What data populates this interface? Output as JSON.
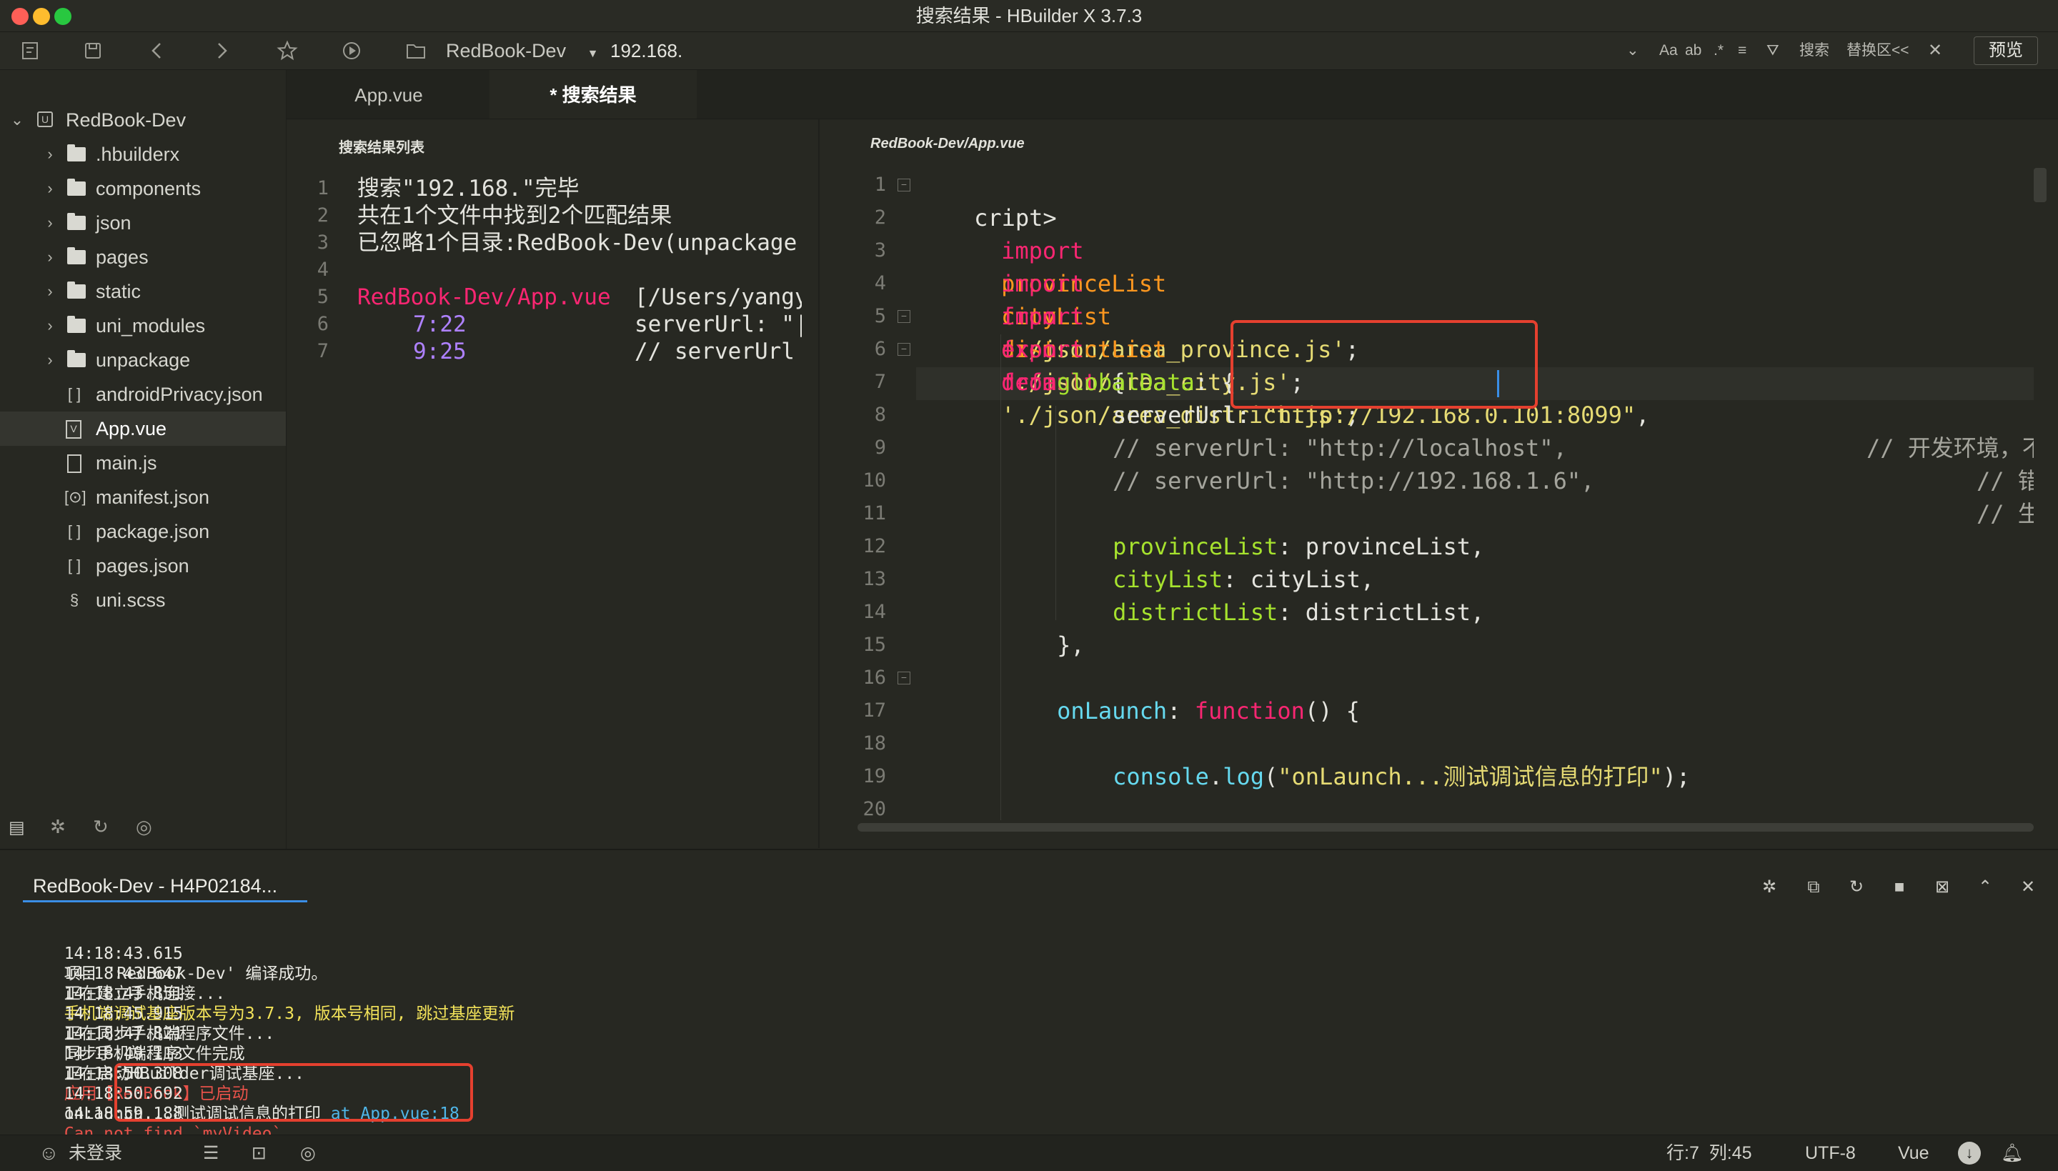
{
  "window": {
    "title": "搜索结果 - HBuilder X 3.7.3"
  },
  "toolbar": {
    "project": "RedBook-Dev",
    "search_value": "192.168.",
    "search_label": "搜索",
    "replace_label": "替换区<<",
    "preview_label": "预览"
  },
  "sidebar": {
    "root": "RedBook-Dev",
    "items": [
      {
        "label": ".hbuilderx",
        "type": "folder"
      },
      {
        "label": "components",
        "type": "folder"
      },
      {
        "label": "json",
        "type": "folder"
      },
      {
        "label": "pages",
        "type": "folder"
      },
      {
        "label": "static",
        "type": "folder"
      },
      {
        "label": "uni_modules",
        "type": "folder"
      },
      {
        "label": "unpackage",
        "type": "folder"
      },
      {
        "label": "androidPrivacy.json",
        "type": "json"
      },
      {
        "label": "App.vue",
        "type": "vue"
      },
      {
        "label": "main.js",
        "type": "js"
      },
      {
        "label": "manifest.json",
        "type": "manifest"
      },
      {
        "label": "package.json",
        "type": "json"
      },
      {
        "label": "pages.json",
        "type": "json"
      },
      {
        "label": "uni.scss",
        "type": "scss"
      }
    ]
  },
  "tabs": [
    {
      "label": "App.vue"
    },
    {
      "label": "* 搜索结果"
    }
  ],
  "results": {
    "title": "搜索结果列表",
    "line_numbers": [
      "1",
      "2",
      "3",
      "4",
      "5",
      "6",
      "7"
    ],
    "lines": [
      "搜索\"192.168.\"完毕",
      "共在1个文件中找到2个匹配结果",
      "已忽略1个目录:RedBook-Dev(unpackage",
      "",
      "RedBook-Dev/App.vue",
      "7:22",
      "9:25"
    ],
    "file_path_suffix": "[/Users/yangy",
    "match_7_22": "serverUrl: \"|",
    "match_9_25": "// serverUrl"
  },
  "editor": {
    "path": "RedBook-Dev/App.vue",
    "line_numbers": [
      "1",
      "2",
      "3",
      "4",
      "5",
      "6",
      "7",
      "8",
      "9",
      "10",
      "11",
      "12",
      "13",
      "14",
      "15",
      "16",
      "17",
      "18",
      "19",
      "20"
    ],
    "l1": "cript>",
    "l2_kw": "import",
    "l2_id": "provinceList",
    "l2_from": "from",
    "l2_str": "'./json/area_province.js'",
    "l2_end": ";",
    "l3_kw": "import",
    "l3_id": "cityList",
    "l3_from": "from",
    "l3_str": "'./json/area_city.js'",
    "l3_end": ";",
    "l4_kw": "import",
    "l4_id": "districtList",
    "l4_from": "from",
    "l4_str": "'./json/area_district.js'",
    "l4_end": ";",
    "l5_kw": "export",
    "l5_kw2": "default",
    "l5_end": " {",
    "l6_key": "globalData",
    "l6_end": ": {",
    "l7_key": "serverUrl: ",
    "l7_str": "\"http://192.168.0.101:8099\"",
    "l7_end": ",",
    "l7_comment": "// 开发环境，不能使用localhost",
    "l8_comment": "// serverUrl: \"http://localhost\",",
    "l8_comment2": "// 错误示范！！！",
    "l9_comment": "// serverUrl: \"http://192.168.1.6\",",
    "l9_comment2": "// 生产环境",
    "l11_key": "provinceList",
    "l11_rest": ": provinceList,",
    "l12_key": "cityList",
    "l12_rest": ": cityList,",
    "l13_key": "districtList",
    "l13_rest": ": districtList,",
    "l14": "},",
    "l16_key": "onLaunch",
    "l16_colon": ": ",
    "l16_fn": "function",
    "l16_rest": "() {",
    "l18_obj": "console",
    "l18_dot": ".",
    "l18_fn": "log",
    "l18_open": "(",
    "l18_str": "\"onLaunch...测试调试信息的打印\"",
    "l18_close": ");"
  },
  "console": {
    "tab_label": "RedBook-Dev - H4P02184...",
    "logs": [
      {
        "time": "14:18:43.615",
        "text": "项目 'RedBook-Dev' 编译成功。",
        "color": "#e8e8e2"
      },
      {
        "time": "14:18:43.647",
        "text": "正在建立手机连接...",
        "color": "#e8e8e2"
      },
      {
        "time": "14:18:43.851",
        "text": "手机端调试基座版本号为3.7.3, 版本号相同, 跳过基座更新",
        "color": "#f3e35a"
      },
      {
        "time": "14:18:45.915",
        "text": "正在同步手机端程序文件...",
        "color": "#e8e8e2"
      },
      {
        "time": "14:18:47.821",
        "text": "同步手机端程序文件完成",
        "color": "#e8e8e2"
      },
      {
        "time": "14:18:49.113",
        "text": "正在启动HBuilder调试基座...",
        "color": "#e8e8e2"
      },
      {
        "time": "14:18:50.308",
        "text": "应用【RedBook】已启动",
        "color": "#e8524a"
      },
      {
        "time": "14:18:50.692",
        "text": "onLaunch...测试调试信息的打印 ",
        "color": "#e8e8e2",
        "link": "at App.vue:18"
      },
      {
        "time": "14:18:59.188",
        "text": "Can not find `myVideo`",
        "color": "#e8524a"
      }
    ]
  },
  "status": {
    "login": "未登录",
    "position": "行:7  列:45",
    "encoding": "UTF-8",
    "language": "Vue"
  },
  "colors": {
    "keyword": "#f92672",
    "string": "#e6db74",
    "identifier": "#fd971f",
    "function": "#66d9ef",
    "comment": "#a5a59d",
    "number": "#ae81ff",
    "accent": "#3a8ee6",
    "error_red": "#e5402f"
  }
}
